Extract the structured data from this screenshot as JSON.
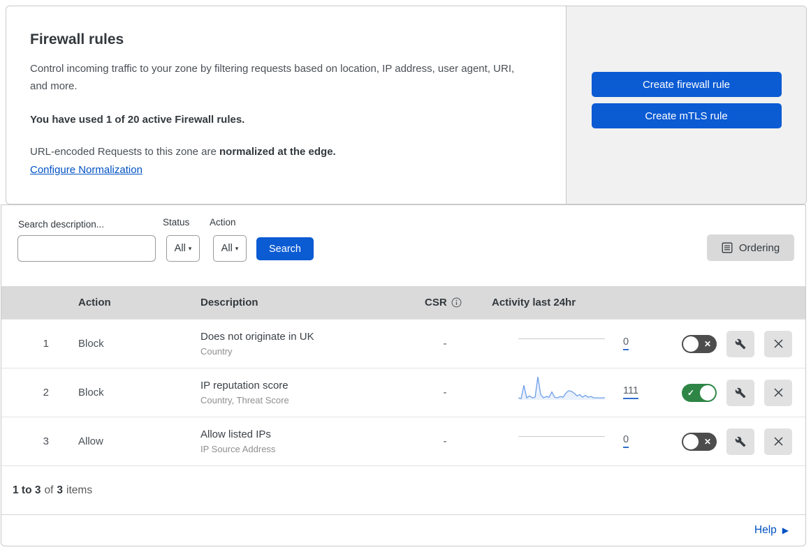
{
  "icons": {
    "caret_down": "▾",
    "cross": "✕",
    "check": "✓",
    "arrow_right": "▶"
  },
  "colors": {
    "primary_blue": "#0b5bd3",
    "link_blue": "#0051c3",
    "toggle_on_green": "#2e8545",
    "toggle_off_gray": "#4d4d4d",
    "sparkline_blue": "#6d9fe8",
    "table_header_gray": "#dadada",
    "panel_gray": "#f1f1f1"
  },
  "header": {
    "title": "Firewall rules",
    "description": "Control incoming traffic to your zone by filtering requests based on location, IP address, user agent, URI, and more.",
    "usage_bold": "You have used 1 of 20 active Firewall rules.",
    "normalization_prefix": "URL-encoded Requests to this zone are ",
    "normalization_bold": "normalized at the edge.",
    "normalization_link": "Configure Normalization",
    "create_firewall_button": "Create firewall rule",
    "create_mtls_button": "Create mTLS rule"
  },
  "filters": {
    "search_label": "Search description...",
    "search_value": "",
    "status_label": "Status",
    "status_value": "All",
    "action_label": "Action",
    "action_value": "All",
    "search_button": "Search",
    "ordering_button": "Ordering"
  },
  "table": {
    "columns": {
      "action": "Action",
      "description": "Description",
      "csr": "CSR",
      "activity": "Activity last 24hr"
    },
    "rows": [
      {
        "priority": "1",
        "action": "Block",
        "description": "Does not originate in UK",
        "fields": "Country",
        "csr": "-",
        "activity": {
          "count": "0",
          "trend": "flat"
        },
        "enabled": false
      },
      {
        "priority": "2",
        "action": "Block",
        "description": "IP reputation score",
        "fields": "Country, Threat Score",
        "csr": "-",
        "activity": {
          "count": "111",
          "sparkline": [
            2,
            1,
            21,
            2,
            5,
            2,
            3,
            34,
            7,
            2,
            4,
            3,
            11,
            3,
            2,
            4,
            3,
            9,
            13,
            12,
            9,
            5,
            7,
            3,
            6,
            3,
            4,
            2,
            2,
            2,
            2,
            2
          ]
        },
        "enabled": true
      },
      {
        "priority": "3",
        "action": "Allow",
        "description": "Allow listed IPs",
        "fields": "IP Source Address",
        "csr": "-",
        "activity": {
          "count": "0",
          "trend": "flat"
        },
        "enabled": false
      }
    ],
    "items_summary": {
      "range": "1 to 3",
      "of_label": "of",
      "total": "3",
      "items_label": "items"
    }
  },
  "footer": {
    "help_label": "Help"
  }
}
